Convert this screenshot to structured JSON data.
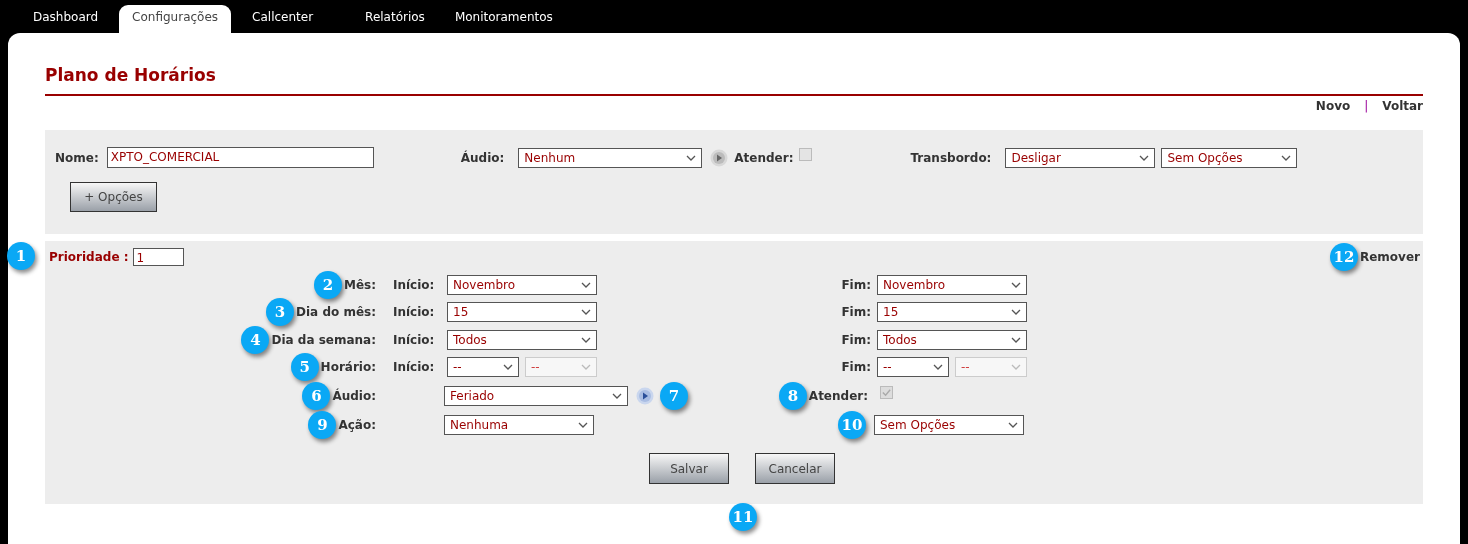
{
  "nav_tabs": [
    {
      "label": "Dashboard",
      "selected": false
    },
    {
      "label": "Configurações",
      "selected": true
    },
    {
      "label": "Callcenter",
      "selected": false
    },
    {
      "label": "Relatórios",
      "selected": false
    },
    {
      "label": "Monitoramentos",
      "selected": false
    }
  ],
  "page_title": "Plano de Horários",
  "actions": [
    "Novo",
    "Voltar"
  ],
  "actions_separator": "|",
  "form": {
    "nome": {
      "label": "Nome:",
      "value": "XPTO_COMERCIAL"
    },
    "audio": {
      "label": "Áudio:",
      "value": "Nenhum"
    },
    "atender": {
      "label": "Atender:",
      "checked": false
    },
    "transbordo": {
      "label": "Transbordo:",
      "values": [
        "Desligar",
        "Sem Opções"
      ]
    },
    "options_button": "+ Opções"
  },
  "rule": {
    "prioridade": {
      "callout": "1",
      "label": "Prioridade :",
      "value": "1"
    },
    "remover": {
      "callout": "12",
      "label": "Remover"
    },
    "range_rows": [
      {
        "callout": "2",
        "label": "Mês:",
        "start_label": "Início:",
        "start": [
          {
            "value": "Novembro",
            "disabled": false
          }
        ],
        "end_label": "Fim:",
        "end": [
          {
            "value": "Novembro",
            "disabled": false
          }
        ]
      },
      {
        "callout": "3",
        "label": "Dia do mês:",
        "start_label": "Início:",
        "start": [
          {
            "value": "15",
            "disabled": false
          }
        ],
        "end_label": "Fim:",
        "end": [
          {
            "value": "15",
            "disabled": false
          }
        ]
      },
      {
        "callout": "4",
        "label": "Dia da semana:",
        "start_label": "Início:",
        "start": [
          {
            "value": "Todos",
            "disabled": false
          }
        ],
        "end_label": "Fim:",
        "end": [
          {
            "value": "Todos",
            "disabled": false
          }
        ]
      },
      {
        "callout": "5",
        "label": "Horário:",
        "start_label": "Início:",
        "start": [
          {
            "value": "--",
            "disabled": false
          },
          {
            "value": "--",
            "disabled": true
          }
        ],
        "end_label": "Fim:",
        "end": [
          {
            "value": "--",
            "disabled": false
          },
          {
            "value": "--",
            "disabled": true
          }
        ]
      }
    ],
    "audio": {
      "callout": "6",
      "label": "Áudio:",
      "value": "Feriado",
      "play_callout": "7"
    },
    "atender": {
      "callout": "8",
      "label": "Atender:",
      "checked": true,
      "disabled": true
    },
    "acao": {
      "callout": "9",
      "label": "Ação:",
      "value": "Nenhuma"
    },
    "acao_option": {
      "callout": "10",
      "value": "Sem Opções"
    },
    "buttons": [
      "Salvar",
      "Cancelar"
    ],
    "buttons_callout": "11"
  }
}
